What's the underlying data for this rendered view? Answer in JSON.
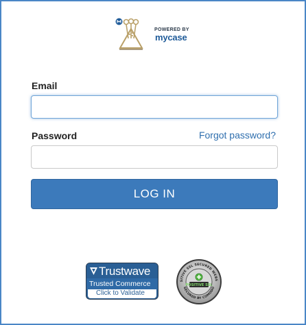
{
  "logo": {
    "powered_by": "POWERED BY",
    "brand": "mycase"
  },
  "form": {
    "email_label": "Email",
    "email_value": "",
    "password_label": "Password",
    "password_value": "",
    "forgot_link": "Forgot password?",
    "login_button": "LOG IN"
  },
  "badges": {
    "trustwave": {
      "name": "Trustwave",
      "line1": "Trusted Commerce",
      "line2": "Click to Validate"
    },
    "ssl": {
      "top_text": "POSITIVE SSL SECURED WEBSITE",
      "center": "POSITIVE SSL",
      "bottom_text": "SECURED BY COMODO"
    }
  },
  "colors": {
    "accent": "#3c7abb",
    "link": "#2f6fae",
    "frame_border": "#4a86c6",
    "logo_gold": "#b9a068"
  }
}
